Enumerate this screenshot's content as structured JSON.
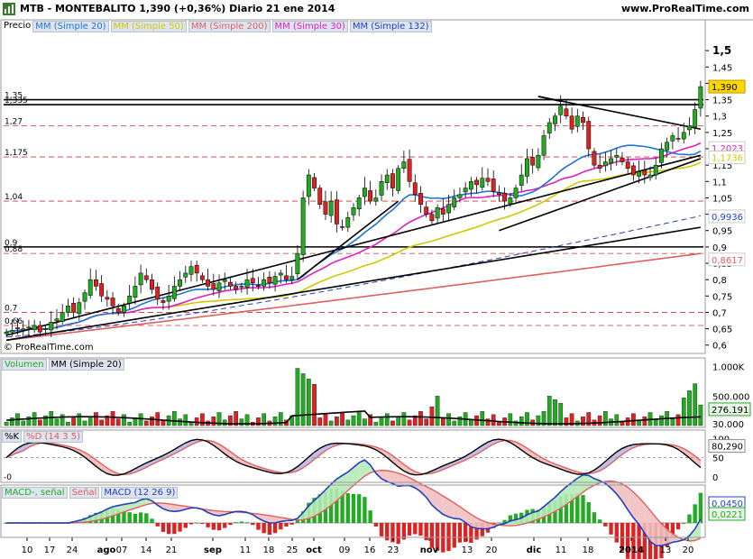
{
  "header": {
    "title": "MTB - MONTEBALITO     1,390 (+0,36%)     Diario  21 ene 2014",
    "url": "www.ProRealTime.com"
  },
  "copyright": "© ProRealTime.com",
  "legends": {
    "price": [
      {
        "text": "Precio",
        "color": "#000000",
        "box": false
      },
      {
        "text": "MM (Simple 20)",
        "color": "#1e74d8",
        "box": true
      },
      {
        "text": "MM (Simple 50)",
        "color": "#d2c800",
        "box": true
      },
      {
        "text": "MM (Simple 200)",
        "color": "#e06060",
        "box": true
      },
      {
        "text": "MM (Simple 30)",
        "color": "#e020c0",
        "box": true
      },
      {
        "text": "MM (Simple 132)",
        "color": "#2040c0",
        "box": true
      }
    ],
    "volume": [
      {
        "text": "Volumen",
        "color": "#22aa22",
        "box": true
      },
      {
        "text": "MM (Simple 20)",
        "color": "#000000",
        "box": true
      }
    ],
    "stoch": [
      {
        "text": "%K",
        "color": "#000000",
        "box": true
      },
      {
        "text": "%D (14 3 5)",
        "color": "#e06060",
        "box": true
      }
    ],
    "macd": [
      {
        "text": "MACD-, señal",
        "color": "#22aa22",
        "box": true
      },
      {
        "text": "Señal",
        "color": "#e06060",
        "box": true
      },
      {
        "text": "MACD (12 26 9)",
        "color": "#2040c0",
        "box": true
      }
    ]
  },
  "colors": {
    "up": "#22aa22",
    "down": "#dd2222",
    "ma20": "#1e74d8",
    "ma50": "#d2c800",
    "ma200": "#e06060",
    "ma30": "#e020c0",
    "ma132": "#2040c0",
    "hline_dash": "#cc3333"
  },
  "chart_data": [
    {
      "type": "candlestick",
      "panel": "price",
      "y_axis_ticks": [
        "1,5",
        "1,45",
        "1,4",
        "1,35",
        "1,3",
        "1,25",
        "1,2",
        "1,15",
        "1,1",
        "1,05",
        "1",
        "0,95",
        "0,9",
        "0,85",
        "0,8",
        "0,75",
        "0,7",
        "0,65",
        "0,6"
      ],
      "ylim": [
        0.58,
        1.55
      ],
      "x_axis_labels": [
        "10",
        "17",
        "24",
        "ago",
        "07",
        "14",
        "21",
        "sep",
        "11",
        "18",
        "25",
        "oct",
        "09",
        "16",
        "23",
        "nov",
        "13",
        "20",
        "dic",
        "11",
        "18",
        "2014",
        "13",
        "20"
      ],
      "level_labels": [
        "1,35",
        "1,335",
        "1,27",
        "1,175",
        "1,04",
        "0,9",
        "0,88",
        "0,7",
        "0,66"
      ],
      "levels": [
        1.35,
        1.335,
        1.27,
        1.175,
        1.04,
        0.9,
        0.88,
        0.7,
        0.66
      ],
      "solid_levels": [
        1.35,
        1.335,
        0.9
      ],
      "value_badges": [
        {
          "label": "1,390",
          "value": 1.39,
          "bg": "#ffd700",
          "fg": "#000000"
        },
        {
          "label": "1,2023",
          "value": 1.2023,
          "bg": "#ffffff",
          "fg": "#e020c0"
        },
        {
          "label": "1,1736",
          "value": 1.1736,
          "bg": "#ffffff",
          "fg": "#d2c800"
        },
        {
          "label": "0,9936",
          "value": 0.9936,
          "bg": "#ffffff",
          "fg": "#2040c0"
        },
        {
          "label": "0,8617",
          "value": 0.8617,
          "bg": "#ffffff",
          "fg": "#e06060"
        }
      ],
      "close": [
        0.64,
        0.645,
        0.65,
        0.65,
        0.655,
        0.66,
        0.64,
        0.65,
        0.67,
        0.68,
        0.7,
        0.72,
        0.7,
        0.73,
        0.76,
        0.8,
        0.78,
        0.75,
        0.74,
        0.72,
        0.7,
        0.72,
        0.75,
        0.78,
        0.82,
        0.8,
        0.77,
        0.74,
        0.73,
        0.75,
        0.78,
        0.8,
        0.82,
        0.84,
        0.82,
        0.8,
        0.78,
        0.77,
        0.79,
        0.8,
        0.78,
        0.77,
        0.78,
        0.8,
        0.79,
        0.78,
        0.8,
        0.79,
        0.81,
        0.82,
        0.8,
        0.81,
        0.88,
        1.05,
        1.12,
        1.08,
        1.03,
        1.0,
        1.04,
        0.97,
        0.96,
        0.99,
        1.02,
        1.05,
        1.08,
        1.04,
        1.05,
        1.1,
        1.12,
        1.08,
        1.14,
        1.16,
        1.1,
        1.06,
        1.03,
        1.0,
        0.98,
        1.02,
        1.0,
        1.03,
        1.05,
        1.06,
        1.08,
        1.1,
        1.09,
        1.11,
        1.1,
        1.07,
        1.06,
        1.04,
        1.05,
        1.08,
        1.12,
        1.17,
        1.15,
        1.18,
        1.24,
        1.28,
        1.3,
        1.33,
        1.3,
        1.26,
        1.3,
        1.28,
        1.2,
        1.15,
        1.14,
        1.16,
        1.17,
        1.18,
        1.16,
        1.14,
        1.12,
        1.13,
        1.12,
        1.12,
        1.15,
        1.2,
        1.22,
        1.24,
        1.23,
        1.25,
        1.27,
        1.32,
        1.39
      ]
    },
    {
      "type": "bar",
      "panel": "volume",
      "series_name": "Volumen",
      "y_axis_ticks": [
        "1.000K",
        "500.000",
        "276.191",
        "30.000"
      ],
      "ylim": [
        0,
        1100000
      ],
      "latest_label": "276.191"
    },
    {
      "type": "line",
      "panel": "stochastic",
      "series": [
        {
          "name": "%K"
        },
        {
          "name": "%D (14 3 5)"
        }
      ],
      "y_axis_ticks": [
        "100",
        "80,290",
        "50",
        "0"
      ],
      "ylim": [
        -10,
        110
      ],
      "latest_label": "80,290",
      "zero_label": "-0"
    },
    {
      "type": "line",
      "panel": "macd",
      "series": [
        {
          "name": "MACD-, señal"
        },
        {
          "name": "Señal"
        },
        {
          "name": "MACD (12 26 9)"
        }
      ],
      "y_axis_ticks": [
        "0,0450",
        "0,0221",
        "0"
      ],
      "latest_macd_label": "0,0450",
      "latest_signal_label": "0,0221"
    }
  ]
}
